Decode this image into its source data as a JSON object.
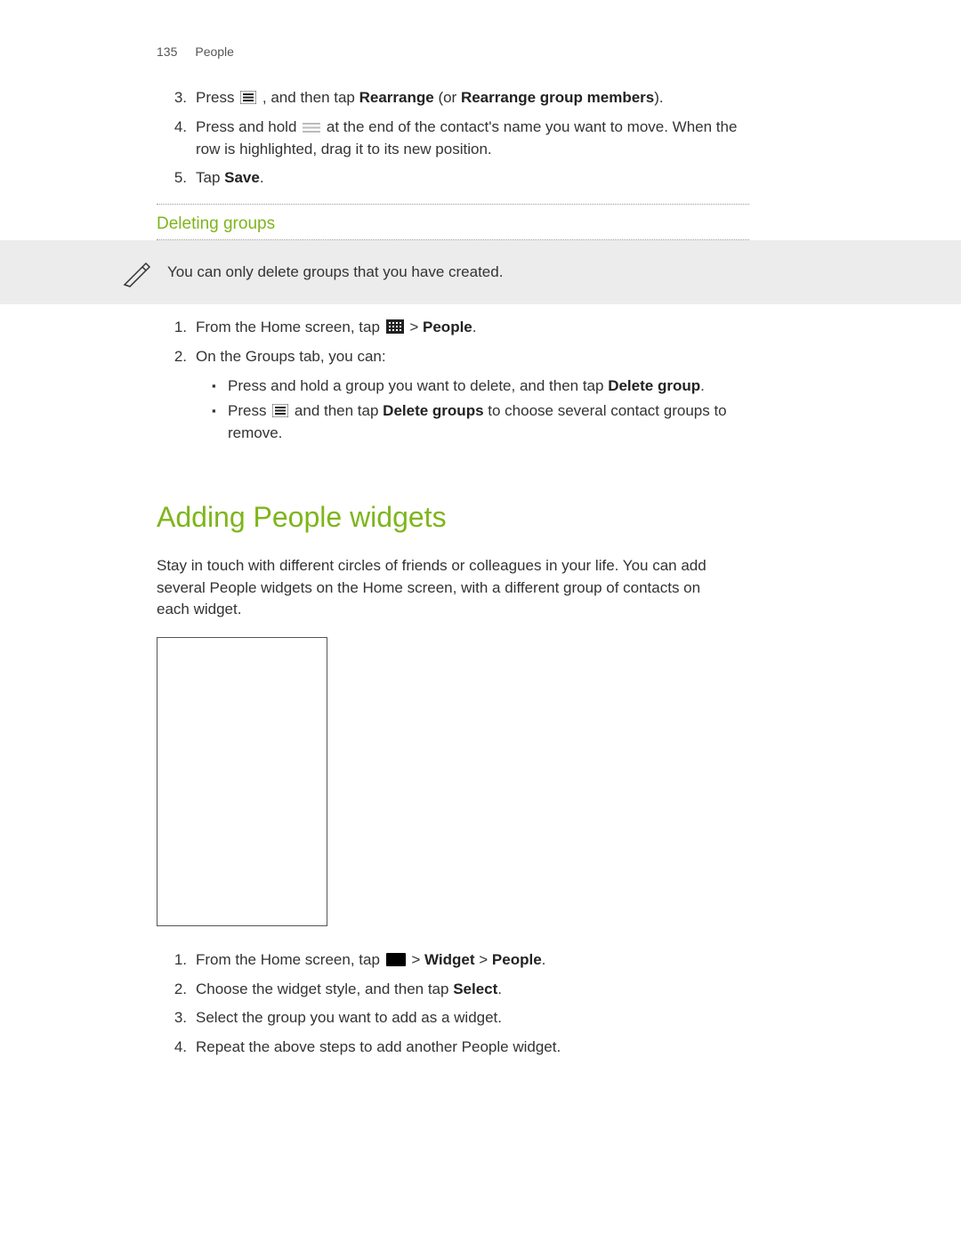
{
  "header": {
    "page_number": "135",
    "section": "People"
  },
  "steps_a": {
    "s3_a": "Press ",
    "s3_b": " , and then tap ",
    "s3_rearrange": "Rearrange",
    "s3_c": " (or ",
    "s3_rearrange_members": "Rearrange group members",
    "s3_d": ").",
    "s4_a": "Press and hold ",
    "s4_b": " at the end of the contact's name you want to move. When the row is highlighted, drag it to its new position.",
    "s5_a": "Tap ",
    "s5_save": "Save",
    "s5_b": "."
  },
  "subheading_deleting": "Deleting groups",
  "note_text": "You can only delete groups that you have created.",
  "steps_b": {
    "s1_a": "From the Home screen, tap ",
    "s1_b": "  > ",
    "s1_people": "People",
    "s1_c": ".",
    "s2": "On the Groups tab, you can:"
  },
  "bullets_b": {
    "b1_a": "Press and hold a group you want to delete, and then tap ",
    "b1_delete_group": "Delete group",
    "b1_b": ".",
    "b2_a": "Press ",
    "b2_b": " and then tap ",
    "b2_delete_groups": "Delete groups",
    "b2_c": " to choose several contact groups to remove."
  },
  "h1_widgets": "Adding People widgets",
  "para_widgets": "Stay in touch with different circles of friends or colleagues in your life. You can add several People widgets on the Home screen, with a different group of contacts on each widget.",
  "steps_c": {
    "s1_a": "From the Home screen, tap ",
    "s1_b": "  > ",
    "s1_widget": "Widget",
    "s1_c": " > ",
    "s1_people": "People",
    "s1_d": ".",
    "s2_a": "Choose the widget style, and then tap ",
    "s2_select": "Select",
    "s2_b": ".",
    "s3": "Select the group you want to add as a widget.",
    "s4": "Repeat the above steps to add another People widget."
  },
  "nums": {
    "n1": "1.",
    "n2": "2.",
    "n3": "3.",
    "n4": "4.",
    "n5": "5."
  },
  "bullet": "▪"
}
